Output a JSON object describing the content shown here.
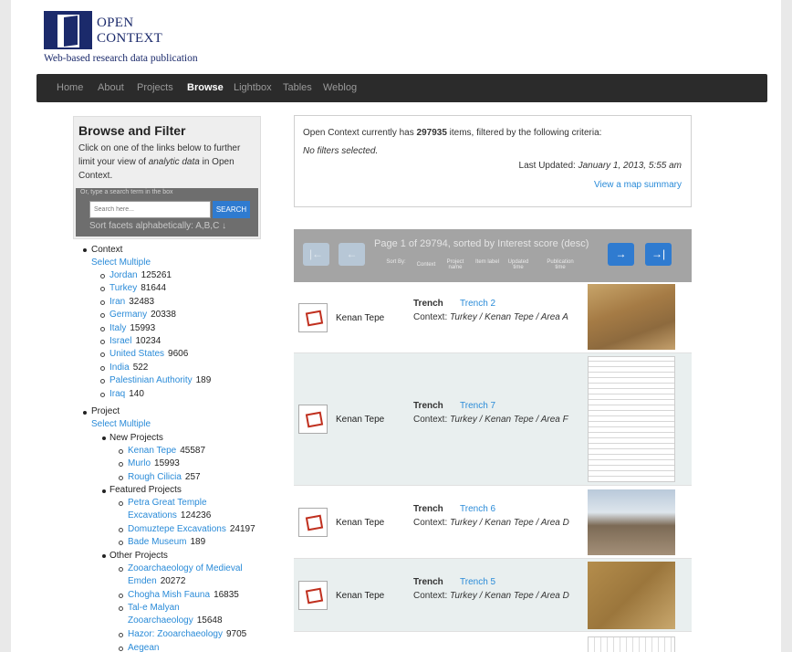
{
  "logo": {
    "line1": "OPEN",
    "line2": "CONTEXT",
    "tagline": "Web-based research data publication"
  },
  "nav": [
    "Home",
    "About",
    "Projects",
    "Browse",
    "Lightbox",
    "Tables",
    "Weblog"
  ],
  "nav_active": "Browse",
  "sidebar": {
    "title": "Browse and Filter",
    "desc_1": "Click on one of the links below to further limit your view of ",
    "desc_em": "analytic data",
    "desc_2": " in Open Context.",
    "search_hint": "Or, type a search term in the box",
    "search_placeholder": "Search here...",
    "search_button": "SEARCH",
    "sort_label": "Sort facets alphabetically:",
    "sort_link": "A,B,C ↓"
  },
  "facets": {
    "context": {
      "label": "Context",
      "select_multiple": "Select Multiple",
      "items": [
        {
          "name": "Jordan",
          "count": "125261"
        },
        {
          "name": "Turkey",
          "count": "81644"
        },
        {
          "name": "Iran",
          "count": "32483"
        },
        {
          "name": "Germany",
          "count": "20338"
        },
        {
          "name": "Italy",
          "count": "15993"
        },
        {
          "name": "Israel",
          "count": "10234"
        },
        {
          "name": "United States",
          "count": "9606"
        },
        {
          "name": "India",
          "count": "522"
        },
        {
          "name": "Palestinian Authority",
          "count": "189"
        },
        {
          "name": "Iraq",
          "count": "140"
        }
      ]
    },
    "project": {
      "label": "Project",
      "select_multiple": "Select Multiple",
      "new_label": "New Projects",
      "new_items": [
        {
          "name": "Kenan Tepe",
          "count": "45587"
        },
        {
          "name": "Murlo",
          "count": "15993"
        },
        {
          "name": "Rough Cilicia",
          "count": "257"
        }
      ],
      "featured_label": "Featured Projects",
      "featured_items": [
        {
          "name": "Petra Great Temple",
          "name2": "Excavations",
          "count": "124236"
        },
        {
          "name": "Domuztepe Excavations",
          "count": "24197"
        },
        {
          "name": "Bade Museum",
          "count": "189"
        }
      ],
      "other_label": "Other Projects",
      "other_items": [
        {
          "name": "Zooarchaeology of Medieval",
          "name2": "Emden",
          "count": "20272"
        },
        {
          "name": "Chogha Mish Fauna",
          "count": "16835"
        },
        {
          "name": "Tal-e Malyan",
          "name2": "Zooarchaeology",
          "count": "15648"
        },
        {
          "name": "Hazor: Zooarchaeology",
          "count": "9705"
        },
        {
          "name": "Aegean",
          "count": ""
        }
      ]
    }
  },
  "info": {
    "prefix": "Open Context currently has ",
    "count": "297935",
    "suffix": " items, filtered by the following criteria:",
    "no_filters": "No filters selected.",
    "updated_label": "Last Updated: ",
    "updated_value": "January 1, 2013, 5:55 am",
    "map_link": "View a map summary"
  },
  "results_header": {
    "page_text": "Page 1 of 29794, sorted by Interest score (desc)",
    "sort_by": "Sort By:",
    "sort_options": [
      "Context",
      "Project name",
      "Item label",
      "Updated time",
      "Publication time"
    ],
    "first": "|←",
    "prev": "←",
    "next": "→",
    "last": "→|"
  },
  "results": [
    {
      "project": "Kenan Tepe",
      "category": "Trench",
      "label": "Trench 2",
      "ctx_prefix": "Context: ",
      "ctx": "Turkey / Kenan Tepe / Area A"
    },
    {
      "project": "Kenan Tepe",
      "category": "Trench",
      "label": "Trench 7",
      "ctx_prefix": "Context: ",
      "ctx": "Turkey / Kenan Tepe / Area F"
    },
    {
      "project": "Kenan Tepe",
      "category": "Trench",
      "label": "Trench 6",
      "ctx_prefix": "Context: ",
      "ctx": "Turkey / Kenan Tepe / Area D"
    },
    {
      "project": "Kenan Tepe",
      "category": "Trench",
      "label": "Trench 5",
      "ctx_prefix": "Context: ",
      "ctx": "Turkey / Kenan Tepe / Area D"
    }
  ]
}
